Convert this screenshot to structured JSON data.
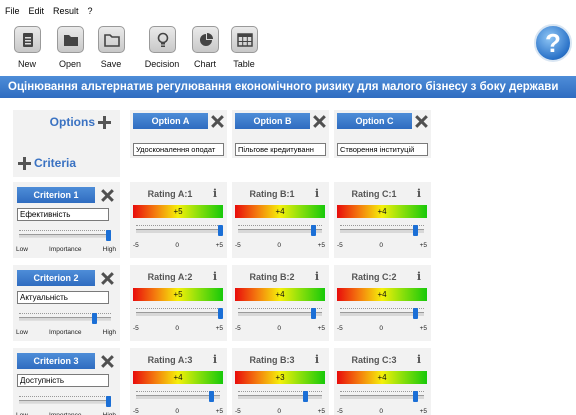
{
  "menu": [
    "File",
    "Edit",
    "Result",
    "?"
  ],
  "toolbar": {
    "new": "New",
    "open": "Open",
    "save": "Save",
    "decision": "Decision",
    "chart": "Chart",
    "table": "Table"
  },
  "title": "Оцінювання альтернатив регулювання економічного ризику для малого бізнесу з боку держави",
  "panel": {
    "options_label": "Options",
    "criteria_label": "Criteria"
  },
  "options": [
    {
      "label": "Option A",
      "value": "Удосконалення оподат"
    },
    {
      "label": "Option B",
      "value": "Пільгове кредитуванн"
    },
    {
      "label": "Option C",
      "value": "Створення інституцій"
    }
  ],
  "criteria": [
    {
      "label": "Criterion 1",
      "value": "Ефективність",
      "importance": 1.0
    },
    {
      "label": "Criterion 2",
      "value": "Актуальність",
      "importance": 0.85
    },
    {
      "label": "Criterion 3",
      "value": "Доступність",
      "importance": 1.0
    }
  ],
  "importance_scale": {
    "low": "Low",
    "mid": "Importance",
    "high": "High"
  },
  "rating_scale": {
    "min": "-5",
    "mid": "0",
    "max": "+5"
  },
  "info_glyph": "i",
  "ratings": [
    [
      {
        "label": "Rating A:1",
        "value": "+5"
      },
      {
        "label": "Rating B:1",
        "value": "+4"
      },
      {
        "label": "Rating C:1",
        "value": "+4"
      }
    ],
    [
      {
        "label": "Rating A:2",
        "value": "+5"
      },
      {
        "label": "Rating B:2",
        "value": "+4"
      },
      {
        "label": "Rating C:2",
        "value": "+4"
      }
    ],
    [
      {
        "label": "Rating A:3",
        "value": "+4"
      },
      {
        "label": "Rating B:3",
        "value": "+3"
      },
      {
        "label": "Rating C:3",
        "value": "+4"
      }
    ]
  ],
  "help_glyph": "?"
}
